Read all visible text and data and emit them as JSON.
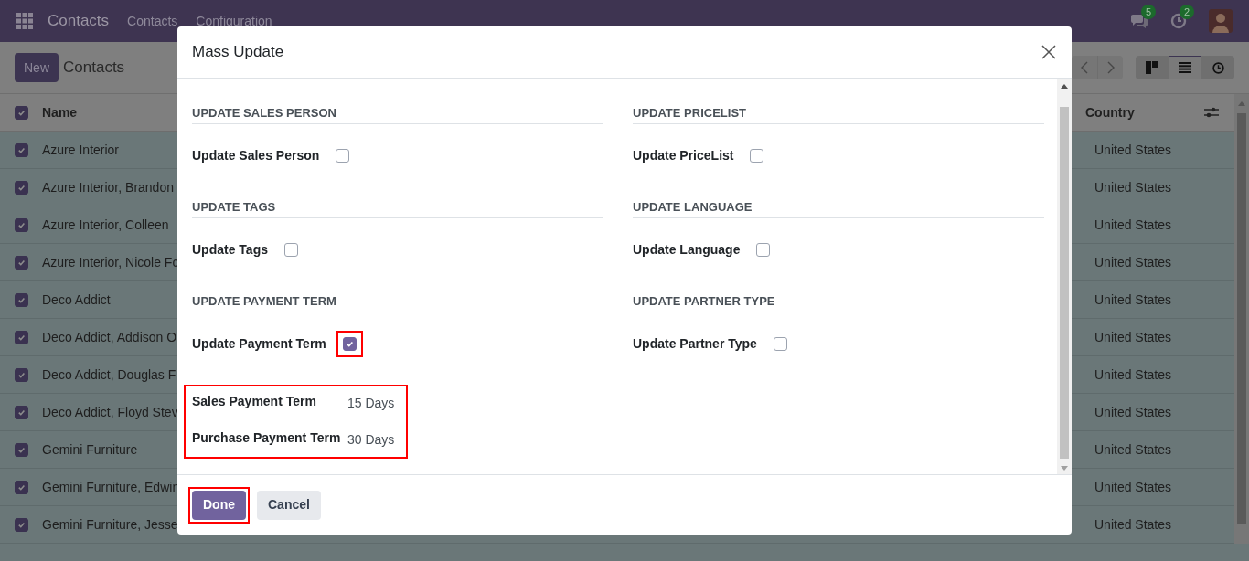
{
  "nav": {
    "app_title": "Contacts",
    "menu": [
      "Contacts",
      "Configuration"
    ],
    "messages_badge": "5",
    "activities_badge": "2"
  },
  "control": {
    "new_button": "New",
    "breadcrumb": "Contacts",
    "views": [
      {
        "kind": "kanban",
        "selected": false
      },
      {
        "kind": "list",
        "selected": true
      },
      {
        "kind": "activity",
        "selected": false
      }
    ]
  },
  "list": {
    "header_checked": true,
    "columns": [
      "Name",
      "Country"
    ],
    "rows": [
      {
        "name": "Azure Interior",
        "checked": true,
        "country": "United States"
      },
      {
        "name": "Azure Interior, Brandon",
        "checked": true,
        "country": "United States"
      },
      {
        "name": "Azure Interior, Colleen",
        "checked": true,
        "country": "United States"
      },
      {
        "name": "Azure Interior, Nicole Fo",
        "checked": true,
        "country": "United States"
      },
      {
        "name": "Deco Addict",
        "checked": true,
        "country": "United States"
      },
      {
        "name": "Deco Addict, Addison O",
        "checked": true,
        "country": "United States"
      },
      {
        "name": "Deco Addict, Douglas F",
        "checked": true,
        "country": "United States"
      },
      {
        "name": "Deco Addict, Floyd Stev",
        "checked": true,
        "country": "United States"
      },
      {
        "name": "Gemini Furniture",
        "checked": true,
        "country": "United States"
      },
      {
        "name": "Gemini Furniture, Edwin",
        "checked": true,
        "country": "United States"
      },
      {
        "name": "Gemini Furniture, Jesse",
        "checked": true,
        "country": "United States"
      }
    ]
  },
  "dialog": {
    "title": "Mass Update",
    "columns": [
      [
        {
          "heading": "UPDATE SALES PERSON",
          "field_label": "Update Sales Person",
          "checked": false,
          "highlighted": false
        },
        {
          "heading": "UPDATE TAGS",
          "field_label": "Update Tags",
          "checked": false,
          "highlighted": false
        },
        {
          "heading": "UPDATE PAYMENT TERM",
          "field_label": "Update Payment Term",
          "checked": true,
          "highlighted": true,
          "subfields": [
            {
              "label": "Sales Payment Term",
              "value": "15 Days"
            },
            {
              "label": "Purchase Payment Term",
              "value": "30 Days"
            }
          ]
        }
      ],
      [
        {
          "heading": "UPDATE PRICELIST",
          "field_label": "Update PriceList",
          "checked": false,
          "highlighted": false
        },
        {
          "heading": "UPDATE LANGUAGE",
          "field_label": "Update Language",
          "checked": false,
          "highlighted": false
        },
        {
          "heading": "UPDATE PARTNER TYPE",
          "field_label": "Update Partner Type",
          "checked": false,
          "highlighted": false
        }
      ]
    ],
    "buttons": [
      {
        "label": "Done",
        "kind": "primary",
        "highlighted": true
      },
      {
        "label": "Cancel",
        "kind": "secondary",
        "highlighted": false
      }
    ]
  }
}
